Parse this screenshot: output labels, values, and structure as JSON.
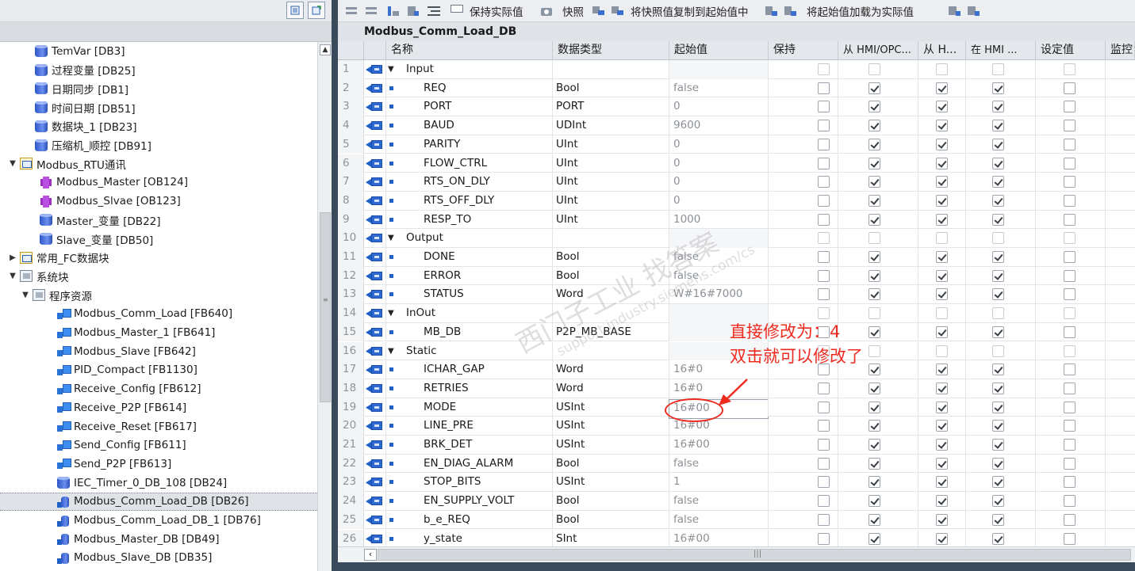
{
  "project_tree": {
    "items": [
      {
        "label": "TemVar [DB3]",
        "level": 1,
        "icon": "db-icon",
        "expand": ""
      },
      {
        "label": "过程变量 [DB25]",
        "level": 1,
        "icon": "db-icon",
        "expand": ""
      },
      {
        "label": "日期同步 [DB1]",
        "level": 1,
        "icon": "db-icon",
        "expand": ""
      },
      {
        "label": "时间日期 [DB51]",
        "level": 1,
        "icon": "db-icon",
        "expand": ""
      },
      {
        "label": "数据块_1 [DB23]",
        "level": 1,
        "icon": "db-icon",
        "expand": ""
      },
      {
        "label": "压缩机_顺控 [DB91]",
        "level": 1,
        "icon": "db-icon",
        "expand": ""
      },
      {
        "label": "Modbus_RTU通讯",
        "level": 0,
        "icon": "folder-icon",
        "expand": "▼"
      },
      {
        "label": "Modbus_Master [OB124]",
        "level": 2,
        "icon": "ob-icon",
        "expand": ""
      },
      {
        "label": "Modbus_Slvae [OB123]",
        "level": 2,
        "icon": "ob-icon",
        "expand": ""
      },
      {
        "label": "Master_变量 [DB22]",
        "level": 2,
        "icon": "db-icon",
        "expand": ""
      },
      {
        "label": "Slave_变量 [DB50]",
        "level": 2,
        "icon": "db-icon",
        "expand": ""
      },
      {
        "label": "常用_FC数据块",
        "level": 0,
        "icon": "folder-icon",
        "expand": "▶"
      },
      {
        "label": "系统块",
        "level": 0,
        "icon": "system-block-icon",
        "expand": "▼"
      },
      {
        "label": "程序资源",
        "level": 1,
        "icon": "system-block-icon",
        "expand": "▼"
      },
      {
        "label": "Modbus_Comm_Load [FB640]",
        "level": 3,
        "icon": "fb-icon",
        "expand": ""
      },
      {
        "label": "Modbus_Master_1 [FB641]",
        "level": 3,
        "icon": "fb-icon",
        "expand": ""
      },
      {
        "label": "Modbus_Slave [FB642]",
        "level": 3,
        "icon": "fb-icon",
        "expand": ""
      },
      {
        "label": "PID_Compact [FB1130]",
        "level": 3,
        "icon": "fb-icon",
        "expand": ""
      },
      {
        "label": "Receive_Config [FB612]",
        "level": 3,
        "icon": "fb-icon",
        "expand": ""
      },
      {
        "label": "Receive_P2P [FB614]",
        "level": 3,
        "icon": "fb-icon",
        "expand": ""
      },
      {
        "label": "Receive_Reset [FB617]",
        "level": 3,
        "icon": "fb-icon",
        "expand": ""
      },
      {
        "label": "Send_Config [FB611]",
        "level": 3,
        "icon": "fb-icon",
        "expand": ""
      },
      {
        "label": "Send_P2P [FB613]",
        "level": 3,
        "icon": "fb-icon",
        "expand": ""
      },
      {
        "label": "IEC_Timer_0_DB_108 [DB24]",
        "level": 3,
        "icon": "db-icon",
        "expand": ""
      },
      {
        "label": "Modbus_Comm_Load_DB [DB26]",
        "level": 3,
        "icon": "instance-db-icon",
        "expand": "",
        "selected": true
      },
      {
        "label": "Modbus_Comm_Load_DB_1 [DB76]",
        "level": 3,
        "icon": "instance-db-icon",
        "expand": ""
      },
      {
        "label": "Modbus_Master_DB [DB49]",
        "level": 3,
        "icon": "instance-db-icon",
        "expand": ""
      },
      {
        "label": "Modbus_Slave_DB [DB35]",
        "level": 3,
        "icon": "instance-db-icon",
        "expand": ""
      }
    ]
  },
  "toolbar": {
    "keep_actual": "保持实际值",
    "snapshot": "快照",
    "copy_snapshot": "将快照值复制到起始值中",
    "load_start": "将起始值加载为实际值"
  },
  "block": {
    "title": "Modbus_Comm_Load_DB",
    "columns": [
      "名称",
      "数据类型",
      "起始值",
      "保持",
      "从 HMI/OPC...",
      "从 H...",
      "在 HMI ...",
      "设定值",
      "监控"
    ],
    "rows": [
      {
        "n": "1",
        "name": "Input",
        "type": "",
        "start": "",
        "section": true,
        "flags": [
          0,
          0,
          0,
          0,
          0
        ]
      },
      {
        "n": "2",
        "name": "REQ",
        "type": "Bool",
        "start": "false",
        "section": false,
        "flags": [
          0,
          1,
          1,
          1,
          0
        ]
      },
      {
        "n": "3",
        "name": "PORT",
        "type": "PORT",
        "start": "0",
        "section": false,
        "flags": [
          0,
          1,
          1,
          1,
          0
        ]
      },
      {
        "n": "4",
        "name": "BAUD",
        "type": "UDInt",
        "start": "9600",
        "section": false,
        "flags": [
          0,
          1,
          1,
          1,
          0
        ]
      },
      {
        "n": "5",
        "name": "PARITY",
        "type": "UInt",
        "start": "0",
        "section": false,
        "flags": [
          0,
          1,
          1,
          1,
          0
        ]
      },
      {
        "n": "6",
        "name": "FLOW_CTRL",
        "type": "UInt",
        "start": "0",
        "section": false,
        "flags": [
          0,
          1,
          1,
          1,
          0
        ]
      },
      {
        "n": "7",
        "name": "RTS_ON_DLY",
        "type": "UInt",
        "start": "0",
        "section": false,
        "flags": [
          0,
          1,
          1,
          1,
          0
        ]
      },
      {
        "n": "8",
        "name": "RTS_OFF_DLY",
        "type": "UInt",
        "start": "0",
        "section": false,
        "flags": [
          0,
          1,
          1,
          1,
          0
        ]
      },
      {
        "n": "9",
        "name": "RESP_TO",
        "type": "UInt",
        "start": "1000",
        "section": false,
        "flags": [
          0,
          1,
          1,
          1,
          0
        ]
      },
      {
        "n": "10",
        "name": "Output",
        "type": "",
        "start": "",
        "section": true,
        "flags": [
          0,
          0,
          0,
          0,
          0
        ]
      },
      {
        "n": "11",
        "name": "DONE",
        "type": "Bool",
        "start": "false",
        "section": false,
        "flags": [
          0,
          1,
          1,
          1,
          0
        ]
      },
      {
        "n": "12",
        "name": "ERROR",
        "type": "Bool",
        "start": "false",
        "section": false,
        "flags": [
          0,
          1,
          1,
          1,
          0
        ]
      },
      {
        "n": "13",
        "name": "STATUS",
        "type": "Word",
        "start": "W#16#7000",
        "section": false,
        "flags": [
          0,
          1,
          1,
          1,
          0
        ]
      },
      {
        "n": "14",
        "name": "InOut",
        "type": "",
        "start": "",
        "section": true,
        "flags": [
          0,
          0,
          0,
          0,
          0
        ]
      },
      {
        "n": "15",
        "name": "MB_DB",
        "type": "P2P_MB_BASE",
        "start": "",
        "section": false,
        "flags": [
          0,
          1,
          1,
          1,
          0
        ]
      },
      {
        "n": "16",
        "name": "Static",
        "type": "",
        "start": "",
        "section": true,
        "flags": [
          0,
          0,
          0,
          0,
          0
        ]
      },
      {
        "n": "17",
        "name": "ICHAR_GAP",
        "type": "Word",
        "start": "16#0",
        "section": false,
        "flags": [
          0,
          1,
          1,
          1,
          0
        ]
      },
      {
        "n": "18",
        "name": "RETRIES",
        "type": "Word",
        "start": "16#0",
        "section": false,
        "flags": [
          0,
          1,
          1,
          1,
          0
        ]
      },
      {
        "n": "19",
        "name": "MODE",
        "type": "USInt",
        "start": "16#00",
        "section": false,
        "flags": [
          0,
          1,
          1,
          1,
          0
        ]
      },
      {
        "n": "20",
        "name": "LINE_PRE",
        "type": "USInt",
        "start": "16#00",
        "section": false,
        "flags": [
          0,
          1,
          1,
          1,
          0
        ]
      },
      {
        "n": "21",
        "name": "BRK_DET",
        "type": "USInt",
        "start": "16#00",
        "section": false,
        "flags": [
          0,
          1,
          1,
          1,
          0
        ]
      },
      {
        "n": "22",
        "name": "EN_DIAG_ALARM",
        "type": "Bool",
        "start": "false",
        "section": false,
        "flags": [
          0,
          1,
          1,
          1,
          0
        ]
      },
      {
        "n": "23",
        "name": "STOP_BITS",
        "type": "USInt",
        "start": "1",
        "section": false,
        "flags": [
          0,
          1,
          1,
          1,
          0
        ]
      },
      {
        "n": "24",
        "name": "EN_SUPPLY_VOLT",
        "type": "Bool",
        "start": "false",
        "section": false,
        "flags": [
          0,
          1,
          1,
          1,
          0
        ]
      },
      {
        "n": "25",
        "name": "b_e_REQ",
        "type": "Bool",
        "start": "false",
        "section": false,
        "flags": [
          0,
          1,
          1,
          1,
          0
        ]
      },
      {
        "n": "26",
        "name": "y_state",
        "type": "SInt",
        "start": "16#00",
        "section": false,
        "flags": [
          0,
          1,
          1,
          1,
          0
        ]
      }
    ]
  },
  "annotation": {
    "line1": "直接修改为：4",
    "line2": "双击就可以修改了",
    "color": "#ef2b1f"
  },
  "watermark": {
    "line1": "西门子工业 找答案",
    "line2": "support.industry.siemens.com/cs"
  }
}
